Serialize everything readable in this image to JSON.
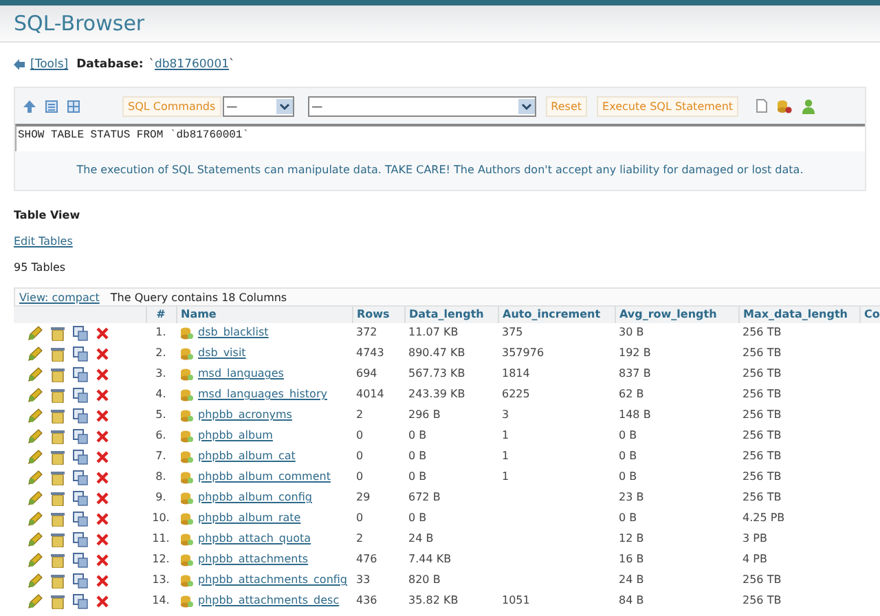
{
  "title": "SQL-Browser",
  "breadcrumb": {
    "tools_link": "[Tools]",
    "database_label": "Database:",
    "open_quote": "`",
    "database_link": "db81760001",
    "close_quote": "`"
  },
  "toolbar": {
    "sql_commands": "SQL Commands",
    "command_select": "—",
    "table_select": "—",
    "reset": "Reset",
    "execute": "Execute SQL Statement"
  },
  "query": "SHOW TABLE STATUS FROM `db81760001`",
  "warning": "The execution of SQL Statements can manipulate data. TAKE CARE! The Authors don't accept any liability for damaged or lost data.",
  "section_title": "Table View",
  "edit_tables_link": "Edit Tables",
  "table_count": "95 Tables",
  "view_link": "View: compact",
  "query_info": "The Query contains 18 Columns",
  "columns": [
    "#",
    "Name",
    "Rows",
    "Data_length",
    "Auto_increment",
    "Avg_row_length",
    "Max_data_length",
    "Co"
  ],
  "rows": [
    {
      "num": "1.",
      "name": "dsb_blacklist",
      "rows": "372",
      "data_length": "11.07 KB",
      "auto_increment": "375",
      "avg_row_length": "30 B",
      "max_data_length": "256 TB"
    },
    {
      "num": "2.",
      "name": "dsb_visit",
      "rows": "4743",
      "data_length": "890.47 KB",
      "auto_increment": "357976",
      "avg_row_length": "192 B",
      "max_data_length": "256 TB"
    },
    {
      "num": "3.",
      "name": "msd_languages",
      "rows": "694",
      "data_length": "567.73 KB",
      "auto_increment": "1814",
      "avg_row_length": "837 B",
      "max_data_length": "256 TB"
    },
    {
      "num": "4.",
      "name": "msd_languages_history",
      "rows": "4014",
      "data_length": "243.39 KB",
      "auto_increment": "6225",
      "avg_row_length": "62 B",
      "max_data_length": "256 TB"
    },
    {
      "num": "5.",
      "name": "phpbb_acronyms",
      "rows": "2",
      "data_length": "296 B",
      "auto_increment": "3",
      "avg_row_length": "148 B",
      "max_data_length": "256 TB"
    },
    {
      "num": "6.",
      "name": "phpbb_album",
      "rows": "0",
      "data_length": "0 B",
      "auto_increment": "1",
      "avg_row_length": "0 B",
      "max_data_length": "256 TB"
    },
    {
      "num": "7.",
      "name": "phpbb_album_cat",
      "rows": "0",
      "data_length": "0 B",
      "auto_increment": "1",
      "avg_row_length": "0 B",
      "max_data_length": "256 TB"
    },
    {
      "num": "8.",
      "name": "phpbb_album_comment",
      "rows": "0",
      "data_length": "0 B",
      "auto_increment": "1",
      "avg_row_length": "0 B",
      "max_data_length": "256 TB"
    },
    {
      "num": "9.",
      "name": "phpbb_album_config",
      "rows": "29",
      "data_length": "672 B",
      "avg_row_length": "23 B",
      "max_data_length": "256 TB"
    },
    {
      "num": "10.",
      "name": "phpbb_album_rate",
      "rows": "0",
      "data_length": "0 B",
      "avg_row_length": "0 B",
      "max_data_length": "4.25 PB"
    },
    {
      "num": "11.",
      "name": "phpbb_attach_quota",
      "rows": "2",
      "data_length": "24 B",
      "avg_row_length": "12 B",
      "max_data_length": "3 PB"
    },
    {
      "num": "12.",
      "name": "phpbb_attachments",
      "rows": "476",
      "data_length": "7.44 KB",
      "avg_row_length": "16 B",
      "max_data_length": "4 PB"
    },
    {
      "num": "13.",
      "name": "phpbb_attachments_config",
      "rows": "33",
      "data_length": "820 B",
      "avg_row_length": "24 B",
      "max_data_length": "256 TB"
    },
    {
      "num": "14.",
      "name": "phpbb_attachments_desc",
      "rows": "436",
      "data_length": "35.82 KB",
      "auto_increment": "1051",
      "avg_row_length": "84 B",
      "max_data_length": "256 TB"
    }
  ]
}
